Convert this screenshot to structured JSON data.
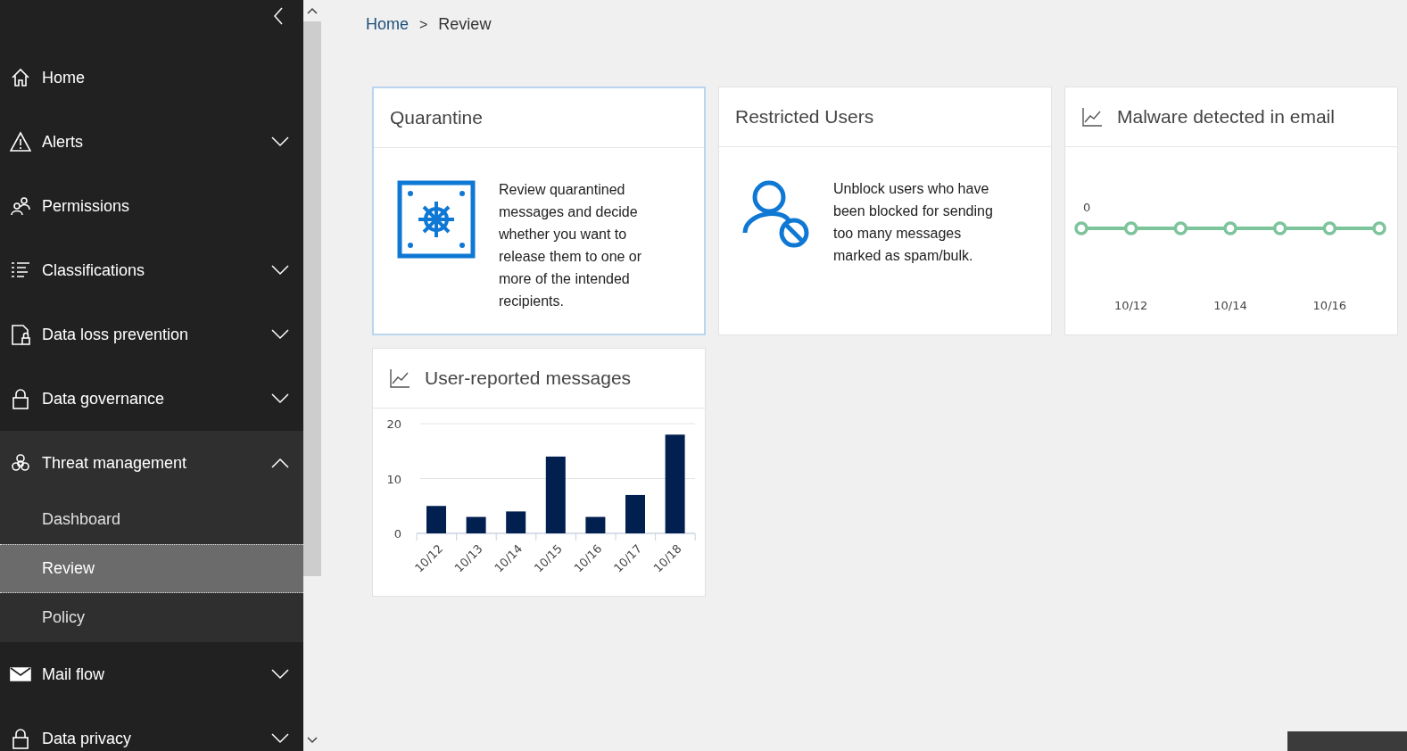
{
  "sidebar": {
    "items": [
      {
        "label": "Home",
        "kind": "link",
        "expanded": false
      },
      {
        "label": "Alerts",
        "kind": "group",
        "expanded": false
      },
      {
        "label": "Permissions",
        "kind": "link",
        "expanded": false
      },
      {
        "label": "Classifications",
        "kind": "group",
        "expanded": false
      },
      {
        "label": "Data loss prevention",
        "kind": "group",
        "expanded": false
      },
      {
        "label": "Data governance",
        "kind": "group",
        "expanded": false
      },
      {
        "label": "Threat management",
        "kind": "group",
        "expanded": true,
        "children": [
          {
            "label": "Dashboard",
            "selected": false
          },
          {
            "label": "Review",
            "selected": true
          },
          {
            "label": "Policy",
            "selected": false
          }
        ]
      },
      {
        "label": "Mail flow",
        "kind": "group",
        "expanded": false
      },
      {
        "label": "Data privacy",
        "kind": "group",
        "expanded": false
      }
    ]
  },
  "breadcrumb": {
    "separator": ">",
    "items": [
      {
        "label": "Home",
        "kind": "link"
      },
      {
        "label": "Review",
        "kind": "current"
      }
    ]
  },
  "cards": [
    {
      "kind": "info",
      "title": "Quarantine",
      "highlighted": true,
      "text": "Review quarantined messages and decide whether you want to release them to one or more of the intended recipients."
    },
    {
      "kind": "info",
      "title": "Restricted Users",
      "highlighted": false,
      "text": "Unblock users who have been blocked for sending too many messages marked as spam/bulk."
    },
    {
      "kind": "line",
      "title": "Malware detected in email",
      "highlighted": false,
      "axis_label": "0",
      "x_labels": [
        "10/12",
        "10/14",
        "10/16"
      ]
    },
    {
      "kind": "bar",
      "title": "User-reported messages",
      "highlighted": false,
      "chart_data": {
        "type": "bar",
        "categories": [
          "10/12",
          "10/13",
          "10/14",
          "10/15",
          "10/16",
          "10/17",
          "10/18"
        ],
        "series": [
          {
            "color": "#012050",
            "values": [
              5,
              3,
              4,
              14,
              3,
              7,
              18
            ]
          }
        ],
        "ylim": [
          0,
          20
        ],
        "yticks": [
          0,
          10,
          20
        ]
      }
    }
  ]
}
